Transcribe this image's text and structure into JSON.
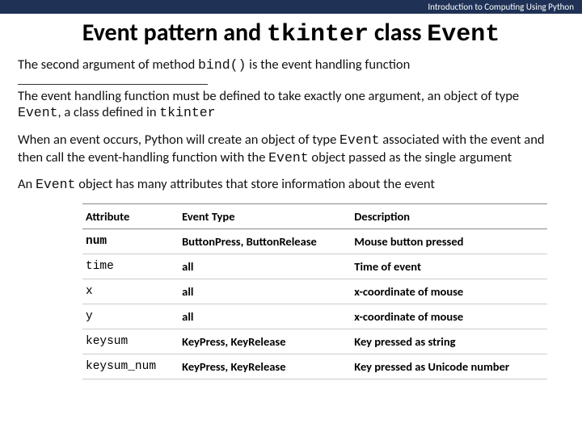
{
  "header": {
    "course": "Introduction to Computing Using Python"
  },
  "title": {
    "pre": "Event pattern and ",
    "mono1": "tkinter",
    "mid": " class ",
    "mono2": "Event"
  },
  "paragraphs": {
    "p1a": "The second argument of method ",
    "p1b": "bind()",
    "p1c": " is the event handling function",
    "p2a": "The event handling function must be defined to take exactly one argument, an object of type ",
    "p2b": "Event",
    "p2c": ", a class defined in ",
    "p2d": "tkinter",
    "p3a": "When an event occurs, Python will create an object of type ",
    "p3b": "Event",
    "p3c": " associated with the event and then call the event-handling function with the ",
    "p3d": "Event",
    "p3e": " object passed as the single argument",
    "p4a": "An ",
    "p4b": "Event",
    "p4c": " object has many attributes that store information about the event"
  },
  "table": {
    "headers": {
      "attr": "Attribute",
      "type": "Event Type",
      "desc": "Description"
    },
    "rows": [
      {
        "attr": "num",
        "type": "ButtonPress, ButtonRelease",
        "desc": "Mouse button pressed"
      },
      {
        "attr": "time",
        "type": "all",
        "desc": "Time of event"
      },
      {
        "attr": "x",
        "type": "all",
        "desc": "x-coordinate of mouse"
      },
      {
        "attr": "y",
        "type": "all",
        "desc": "x-coordinate of mouse"
      },
      {
        "attr": "keysum",
        "type": "KeyPress, KeyRelease",
        "desc": "Key pressed as string"
      },
      {
        "attr": "keysum_num",
        "type": "KeyPress, KeyRelease",
        "desc": "Key pressed as Unicode number"
      }
    ]
  }
}
